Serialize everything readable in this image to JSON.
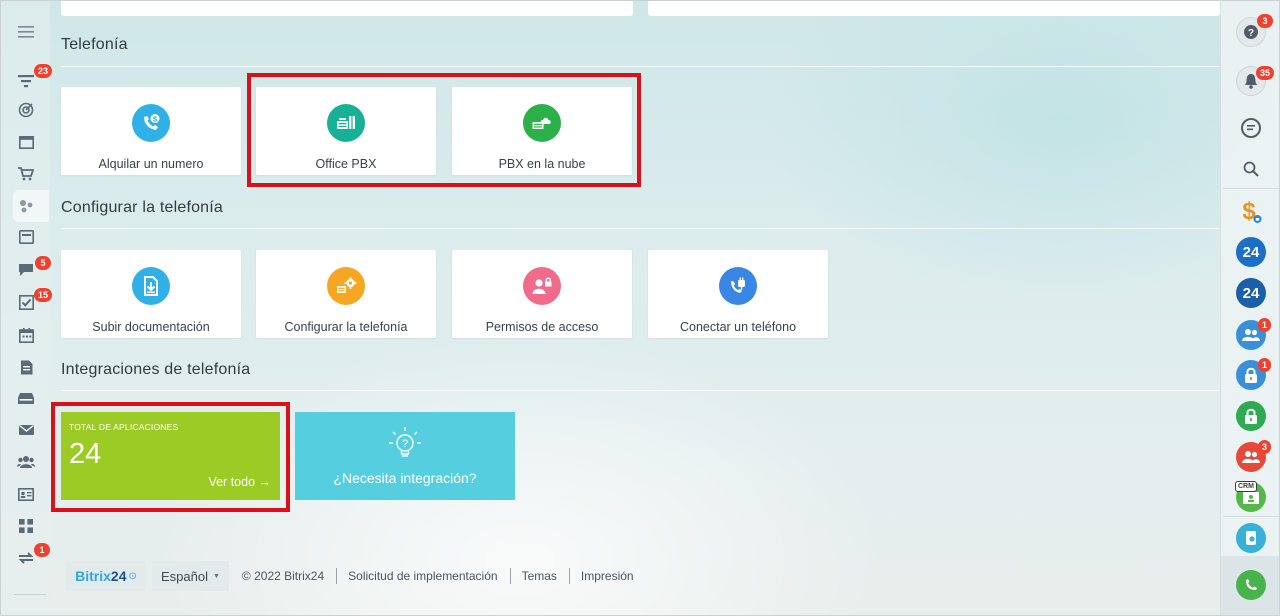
{
  "sections": {
    "telephony": "Telefonía",
    "configure": "Configurar la telefonía",
    "integrations": "Integraciones de telefonía"
  },
  "telephony_tiles": [
    {
      "label": "Alquilar un numero",
      "icon": "phone-dollar-icon",
      "color": "#2fb0e6"
    },
    {
      "label": "Office PBX",
      "icon": "office-pbx-icon",
      "color": "#17b295"
    },
    {
      "label": "PBX en la nube",
      "icon": "cloud-pbx-icon",
      "color": "#2bb04a"
    }
  ],
  "configure_tiles": [
    {
      "label": "Subir documentación",
      "icon": "upload-document-icon",
      "color": "#2fb0e6"
    },
    {
      "label": "Configurar la telefonía",
      "icon": "settings-gear-icon",
      "color": "#f5a623"
    },
    {
      "label": "Permisos de acceso",
      "icon": "user-lock-icon",
      "color": "#f06a8b"
    },
    {
      "label": "Conectar un teléfono",
      "icon": "phone-plug-icon",
      "color": "#3a86e4"
    }
  ],
  "integrations": {
    "apps_caption": "TOTAL DE APLICACIONES",
    "apps_count": "24",
    "view_all": "Ver todo →",
    "need_integration": "¿Necesita integración?",
    "apps_color": "#9ccb25",
    "need_color": "#55cfdf"
  },
  "footer": {
    "logo_a": "Bitrix",
    "logo_b": "24",
    "logo_c": "⊙",
    "language": "Español",
    "copyright": "© 2022 Bitrix24",
    "implementation": "Solicitud de implementación",
    "themes": "Temas",
    "print": "Impresión"
  },
  "left_sidebar": {
    "badges": {
      "filter": "23",
      "chat": "5",
      "tasks": "15",
      "sync": "1"
    }
  },
  "right_sidebar": {
    "badges": {
      "help": "3",
      "notifications": "35",
      "group1": "1",
      "lock1": "1",
      "group2": "3"
    },
    "b24_a": "24",
    "b24_b": "24",
    "crm_label": "CRM"
  },
  "colors": {
    "highlight": "#d8111a",
    "badge": "#f0412f"
  }
}
